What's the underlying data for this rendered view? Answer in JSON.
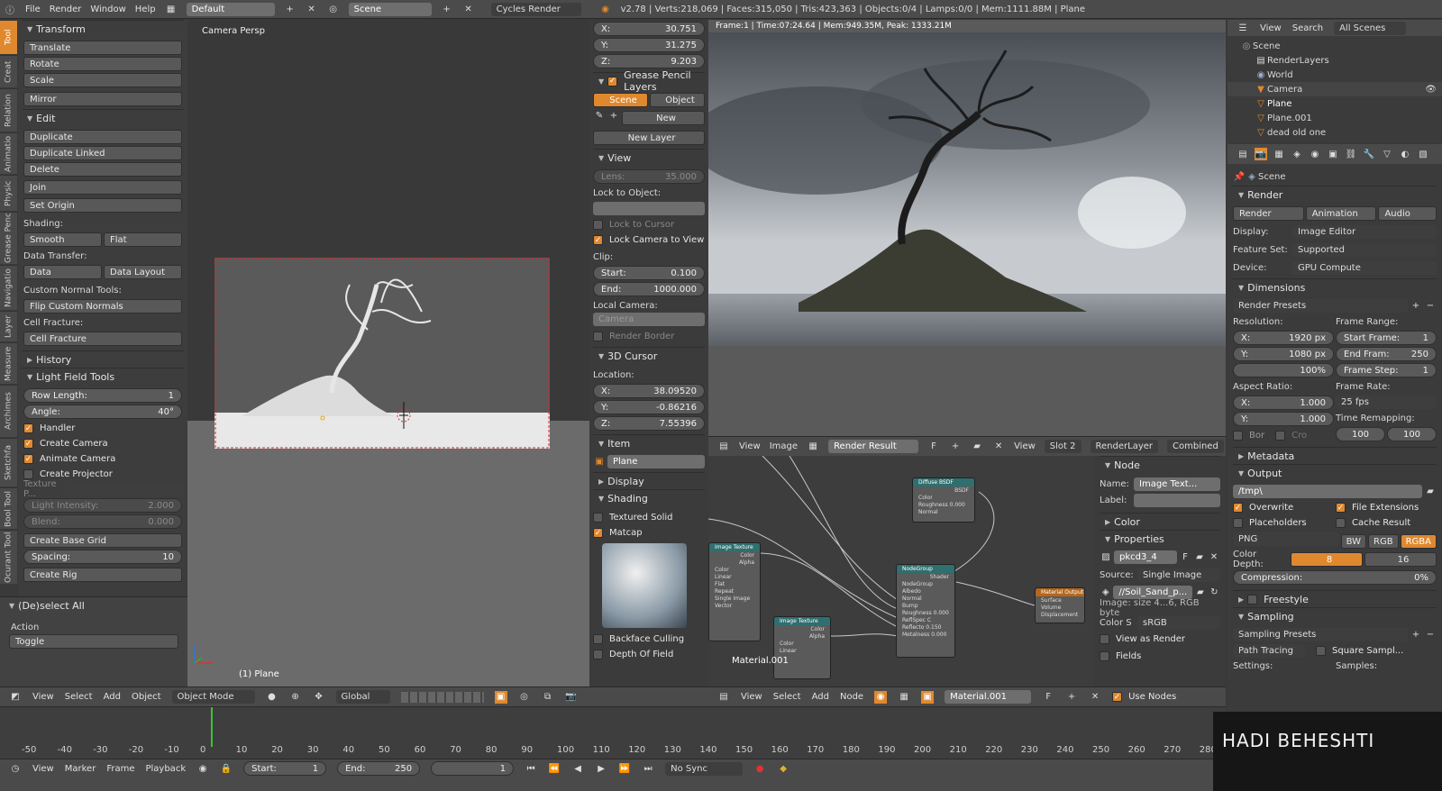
{
  "topbar": {
    "menus": [
      "File",
      "Render",
      "Window",
      "Help"
    ],
    "layout": "Default",
    "scene": "Scene",
    "engine": "Cycles Render",
    "stats": "v2.78 | Verts:218,069 | Faces:315,050 | Tris:423,363 | Objects:0/4 | Lamps:0/0 | Mem:1111.88M | Plane"
  },
  "tooltabs": [
    "Tool",
    "Creat",
    "Relation",
    "Animatio",
    "Physic",
    "Grease Penc",
    "Navigatio",
    "Layer",
    "Measure",
    "Archimes",
    "Sketchfa",
    "Bool Tool",
    "Ocurant Tool"
  ],
  "toolshelf": {
    "transform": {
      "title": "Transform",
      "items": [
        "Translate",
        "Rotate",
        "Scale",
        "Mirror"
      ]
    },
    "edit": {
      "title": "Edit",
      "items": [
        "Duplicate",
        "Duplicate Linked",
        "Delete",
        "Join",
        "Set Origin"
      ],
      "shading_label": "Shading:",
      "smooth": "Smooth",
      "flat": "Flat",
      "data_transfer_label": "Data Transfer:",
      "data": "Data",
      "data_layout": "Data Layout",
      "custom_normal_label": "Custom Normal Tools:",
      "flip": "Flip Custom Normals",
      "cell_label": "Cell Fracture:",
      "cell_btn": "Cell Fracture"
    },
    "history": "History",
    "lightfield": {
      "title": "Light Field Tools",
      "row_length_label": "Row Length:",
      "row_length": "1",
      "angle_label": "Angle:",
      "angle": "40°",
      "handler": "Handler",
      "create_camera": "Create Camera",
      "animate_camera": "Animate Camera",
      "create_projector": "Create Projector",
      "texture": "Texture P...",
      "light_label": "Light Intensity:",
      "light": "2.000",
      "blend_label": "Blend:",
      "blend": "0.000",
      "base_grid": "Create Base Grid",
      "spacing_label": "Spacing:",
      "spacing": "10",
      "rig": "Create Rig"
    },
    "deselect": {
      "title": "(De)select All",
      "action_label": "Action",
      "toggle": "Toggle"
    }
  },
  "viewport": {
    "label": "Camera Persp",
    "object": "(1) Plane"
  },
  "npanel": {
    "x": "30.751",
    "y": "31.275",
    "z": "9.203",
    "grease": {
      "title": "Grease Pencil Layers",
      "scene": "Scene",
      "object": "Object",
      "new": "New",
      "new_layer": "New Layer"
    },
    "view": {
      "title": "View",
      "lens_label": "Lens:",
      "lens": "35.000",
      "lock_obj": "Lock to Object:",
      "lock_cursor": "Lock to Cursor",
      "lock_camera": "Lock Camera to View",
      "clip": "Clip:",
      "start_label": "Start:",
      "start": "0.100",
      "end_label": "End:",
      "end": "1000.000",
      "local_cam": "Local Camera:",
      "camera": "Camera",
      "render_border": "Render Border"
    },
    "cursor": {
      "title": "3D Cursor",
      "location": "Location:",
      "x": "38.09520",
      "y": "-0.86216",
      "z": "7.55396"
    },
    "item": {
      "title": "Item",
      "name": "Plane"
    },
    "display": "Display",
    "shading": {
      "title": "Shading",
      "textured": "Textured Solid",
      "matcap": "Matcap",
      "backface": "Backface Culling",
      "dof": "Depth Of Field"
    }
  },
  "render": {
    "info": "Frame:1 | Time:07:24.64 | Mem:949.35M, Peak: 1333.21M"
  },
  "imgheader": {
    "items": [
      "View",
      "Image"
    ],
    "name": "Render Result",
    "f": "F",
    "view": "View",
    "slot": "Slot 2",
    "layer": "RenderLayer",
    "combined": "Combined"
  },
  "nodes": {
    "diffuse": "Diffuse BSDF",
    "bsdf": "BSDF",
    "color": "Color",
    "roughness": "Roughness 0.000",
    "normal": "Normal",
    "imgtex": "Image Texture",
    "alpha": "Alpha",
    "nodegroup": "NodeGroup",
    "shader": "Shader",
    "albedo": "Albedo",
    "bump": "Bump",
    "output": "Material Output",
    "surface": "Surface",
    "volume": "Volume",
    "displacement": "Displacement",
    "material": "Material.001",
    "vector": "Vector",
    "linear": "Linear",
    "flat": "Flat",
    "repeat": "Repeat",
    "single": "Single Image",
    "reflspec": "ReflSpec C",
    "reflecto": "Reflecto 0.150",
    "metalness": "Metalness 0.000"
  },
  "nodeprops": {
    "node": "Node",
    "name_label": "Name:",
    "name": "Image Text...",
    "label_label": "Label:",
    "color": "Color",
    "properties": "Properties",
    "img": "pkcd3_4",
    "f": "F",
    "source_label": "Source:",
    "source": "Single Image",
    "file": "//Soil_Sand_p...",
    "info": "Image: size 4...6, RGB byte",
    "cs_label": "Color S",
    "cs": "sRGB",
    "view_render": "View as Render",
    "fields": "Fields"
  },
  "outliner": {
    "menus": [
      "View",
      "Search"
    ],
    "filter": "All Scenes",
    "items": [
      "Scene",
      "RenderLayers",
      "World",
      "Camera",
      "Plane",
      "Plane.001",
      "dead old one"
    ]
  },
  "props": {
    "scene": "Scene",
    "render": "Render",
    "r_render": "Render",
    "r_anim": "Animation",
    "r_audio": "Audio",
    "display_label": "Display:",
    "display": "Image Editor",
    "feature_label": "Feature Set:",
    "feature": "Supported",
    "device_label": "Device:",
    "device": "GPU Compute",
    "dimensions": "Dimensions",
    "presets": "Render Presets",
    "res_label": "Resolution:",
    "rx_label": "X:",
    "rx": "1920 px",
    "ry_label": "Y:",
    "ry": "1080 px",
    "rp": "100%",
    "fr_label": "Frame Range:",
    "fs_label": "Start Frame:",
    "fs": "1",
    "fe_label": "End Fram:",
    "fe": "250",
    "fst_label": "Frame Step:",
    "fst": "1",
    "aspect_label": "Aspect Ratio:",
    "ax": "1.000",
    "ay": "1.000",
    "rate_label": "Frame Rate:",
    "rate": "25 fps",
    "remap_label": "Time Remapping:",
    "r1": "100",
    "r2": "100",
    "bor": "Bor",
    "cro": "Cro",
    "metadata": "Metadata",
    "output": "Output",
    "path": "/tmp\\",
    "overwrite": "Overwrite",
    "fileext": "File Extensions",
    "placeholders": "Placeholders",
    "cache": "Cache Result",
    "format": "PNG",
    "bw": "BW",
    "rgb": "RGB",
    "rgba": "RGBA",
    "depth_label": "Color Depth:",
    "d8": "8",
    "d16": "16",
    "compression": "Compression:",
    "comp_val": "0%",
    "freestyle": "Freestyle",
    "sampling": "Sampling",
    "s_presets": "Sampling Presets",
    "tracing": "Path Tracing",
    "square": "Square Sampl...",
    "settings": "Settings:",
    "samples": "Samples:"
  },
  "v3dheader": {
    "items": [
      "View",
      "Select",
      "Add",
      "Object"
    ],
    "mode": "Object Mode",
    "orient": "Global"
  },
  "nodeheader": {
    "items": [
      "View",
      "Select",
      "Add",
      "Node"
    ],
    "material": "Material.001",
    "f": "F",
    "use_nodes": "Use Nodes"
  },
  "timeline": {
    "ticks": [
      "-50",
      "-40",
      "-30",
      "-20",
      "-10",
      "0",
      "10",
      "20",
      "30",
      "40",
      "50",
      "60",
      "70",
      "80",
      "90",
      "100",
      "110",
      "120",
      "130",
      "140",
      "150",
      "160",
      "170",
      "180",
      "190",
      "200",
      "210",
      "220",
      "230",
      "240",
      "250",
      "260",
      "270",
      "280"
    ]
  },
  "bottombar": {
    "items": [
      "View",
      "Marker",
      "Frame",
      "Playback"
    ],
    "start_label": "Start:",
    "start": "1",
    "end_label": "End:",
    "end": "250",
    "current": "1",
    "sync": "No Sync"
  },
  "watermark": "HADI BEHESHTI"
}
